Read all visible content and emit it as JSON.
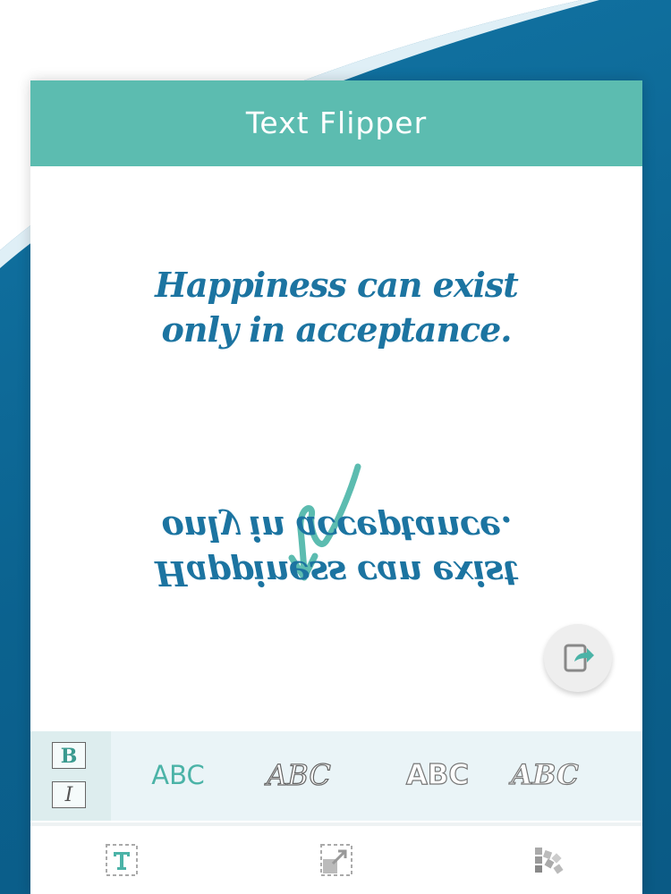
{
  "app": {
    "title": "Text Flipper"
  },
  "canvas": {
    "quote_lines": [
      "Happiness can exist",
      "only in acceptance."
    ],
    "text_color": "#1c74a1",
    "arrow_color": "#5cbcb0"
  },
  "actions": {
    "share_icon": "share-icon"
  },
  "style_bar": {
    "bold_label": "B",
    "italic_label": "I",
    "font_options": [
      "ABC",
      "ABC",
      "ABC",
      "ABC"
    ]
  },
  "bottom_nav": {
    "items": [
      {
        "icon": "text-icon"
      },
      {
        "icon": "resize-icon"
      },
      {
        "icon": "palette-icon"
      }
    ]
  },
  "colors": {
    "header": "#5cbcb0",
    "background": "#0b628f",
    "accent": "#4bb3a7"
  }
}
